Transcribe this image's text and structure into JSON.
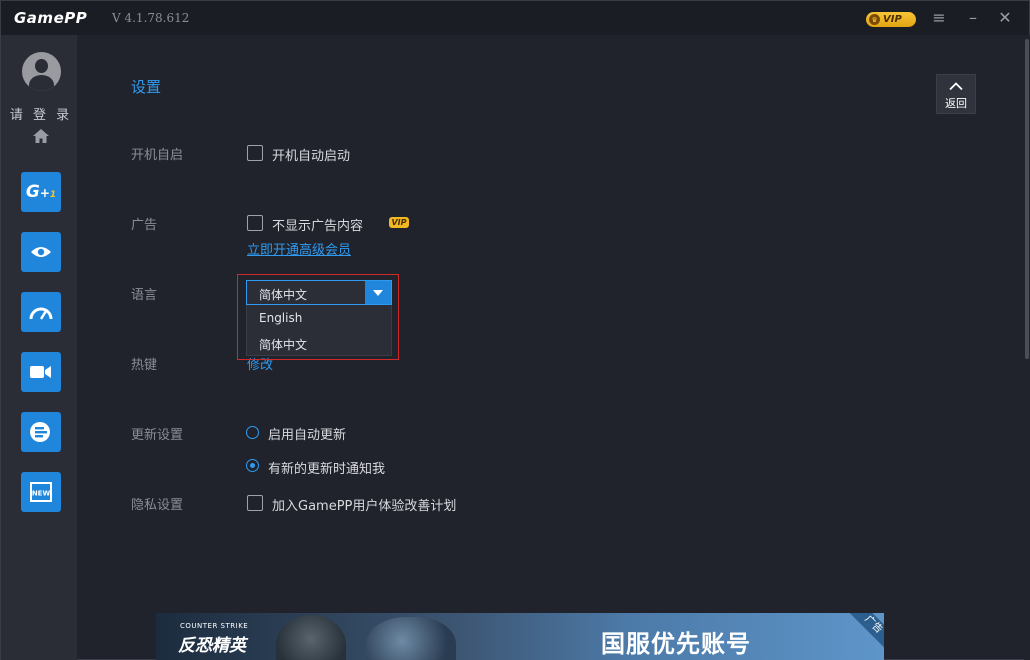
{
  "titlebar": {
    "logo": "GamePP",
    "version": "V 4.1.78.612",
    "vip": "VIP",
    "menu_icon": "hamburger-icon",
    "minimize_icon": "minimize-icon",
    "close_icon": "close-icon"
  },
  "sidebar": {
    "login": "请 登 录",
    "items": [
      {
        "name": "boost",
        "icon": "g-plus-icon",
        "glyph": "G+"
      },
      {
        "name": "monitor",
        "icon": "eye-icon"
      },
      {
        "name": "benchmark",
        "icon": "speedometer-icon"
      },
      {
        "name": "recording",
        "icon": "video-camera-icon"
      },
      {
        "name": "tools",
        "icon": "list-tool-icon"
      },
      {
        "name": "news",
        "icon": "news-icon",
        "glyph": "NEW"
      }
    ]
  },
  "settings": {
    "title": "设置",
    "back": "返回",
    "autostart": {
      "label": "开机自启",
      "option": "开机自动启动",
      "checked": false
    },
    "ads": {
      "label": "广告",
      "option": "不显示广告内容",
      "checked": false,
      "vip_badge": "VIP",
      "link": "立即开通高级会员"
    },
    "language": {
      "label": "语言",
      "selected": "简体中文",
      "options": [
        "English",
        "简体中文"
      ]
    },
    "hotkey": {
      "label": "热键",
      "link": "修改"
    },
    "update": {
      "label": "更新设置",
      "options": [
        {
          "text": "启用自动更新",
          "checked": false
        },
        {
          "text": "有新的更新时通知我",
          "checked": true
        }
      ]
    },
    "privacy": {
      "label": "隐私设置",
      "option": "加入GamePP用户体验改善计划",
      "checked": false
    }
  },
  "banner": {
    "game_small": "COUNTER STRIKE",
    "game_name": "反恐精英",
    "slogan": "国服优先账号",
    "ad_tag": "广告"
  },
  "colors": {
    "accent": "#2e9bf0",
    "sidebar_button": "#1f86db",
    "vip_gold": "#f2b824",
    "highlight_red": "#d22a2a"
  }
}
